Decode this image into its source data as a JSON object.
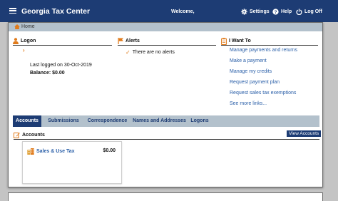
{
  "header": {
    "title": "Georgia Tax Center",
    "welcome": "Welcome,",
    "settings_label": "Settings",
    "help_label": "Help",
    "logoff_label": "Log Off"
  },
  "breadcrumb": {
    "home_label": "Home"
  },
  "logon": {
    "title": "Logon",
    "chevron": "›",
    "last_logged": "Last logged on 30-Oct-2019",
    "balance": "Balance: $0.00"
  },
  "alerts": {
    "title": "Alerts",
    "check": "✓",
    "message": "There are no alerts"
  },
  "i_want_to": {
    "title": "I Want To",
    "links": [
      "Manage payments and returns",
      "Make a payment",
      "Manage my credits",
      "Request payment plan",
      "Request sales tax exemptions",
      "See more links..."
    ]
  },
  "tabs": [
    "Accounts",
    "Submissions",
    "Correspondence",
    "Names and Addresses",
    "Logons"
  ],
  "accounts": {
    "title": "Accounts",
    "view_button": "View Accounts",
    "items": [
      {
        "name": "Sales & Use Tax",
        "amount": "$0.00"
      }
    ]
  },
  "colors": {
    "header_bg": "#1d3c74",
    "accent_orange": "#e07a1a",
    "link_blue": "#2a5fa8",
    "subbar_bg": "#b3c1cc"
  },
  "icons": {
    "menu": "hamburger-icon",
    "settings": "gear-icon",
    "help": "question-icon",
    "logoff": "power-icon",
    "home": "home-icon",
    "logon": "person-icon",
    "alerts": "flag-icon",
    "i_want_to": "clipboard-icon",
    "accounts": "edit-icon",
    "sales_tax": "buildings-icon"
  }
}
